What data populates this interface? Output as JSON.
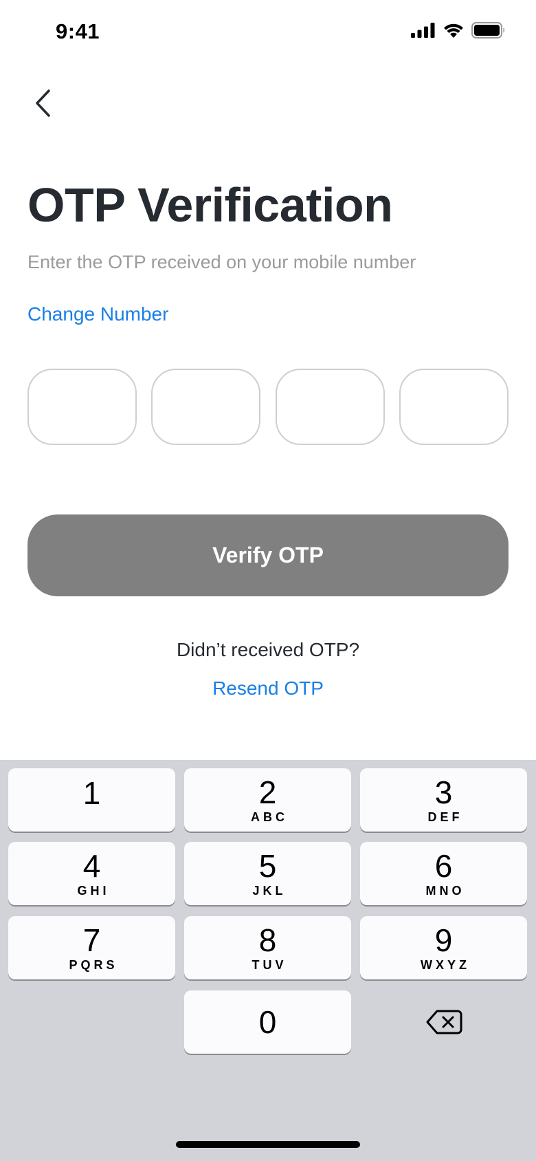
{
  "status_bar": {
    "time": "9:41"
  },
  "header": {
    "title": "OTP Verification",
    "subtitle": "Enter the OTP received on your mobile number",
    "change_number": "Change Number"
  },
  "otp": {
    "digits": [
      "",
      "",
      "",
      ""
    ],
    "box_count": 4
  },
  "actions": {
    "verify_label": "Verify OTP",
    "verify_enabled": false,
    "verify_color": "#808080",
    "resend_prompt": "Didn’t received OTP?",
    "resend_label": "Resend OTP",
    "link_color": "#1a7fe8"
  },
  "keypad": {
    "keys": [
      {
        "digit": "1",
        "letters": ""
      },
      {
        "digit": "2",
        "letters": "ABC"
      },
      {
        "digit": "3",
        "letters": "DEF"
      },
      {
        "digit": "4",
        "letters": "GHI"
      },
      {
        "digit": "5",
        "letters": "JKL"
      },
      {
        "digit": "6",
        "letters": "MNO"
      },
      {
        "digit": "7",
        "letters": "PQRS"
      },
      {
        "digit": "8",
        "letters": "TUV"
      },
      {
        "digit": "9",
        "letters": "WXYZ"
      },
      {
        "digit": "0",
        "letters": ""
      }
    ],
    "delete_icon": "backspace-icon"
  }
}
